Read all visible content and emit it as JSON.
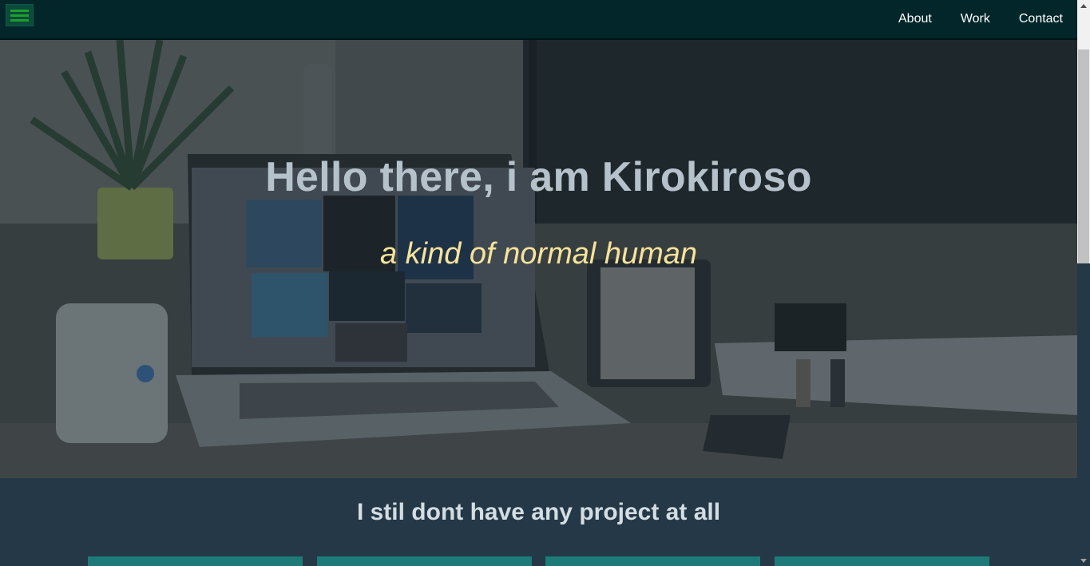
{
  "navbar": {
    "menu_icon": "hamburger-menu-icon",
    "links": [
      {
        "label": "About"
      },
      {
        "label": "Work"
      },
      {
        "label": "Contact"
      }
    ]
  },
  "hero": {
    "title": "Hello there, i am Kirokiroso",
    "subtitle": "a kind of normal human",
    "background_image": "desk-workspace-photo"
  },
  "projects": {
    "heading": "I stil dont have any project at all",
    "card_count": 4
  },
  "colors": {
    "navbar_bg": "#022629",
    "section_bg": "#243847",
    "title_color": "#b5c2cb",
    "subtitle_color": "#f7e39a",
    "card_color": "#1e7a78",
    "menu_icon_color": "#1e9e2c"
  }
}
